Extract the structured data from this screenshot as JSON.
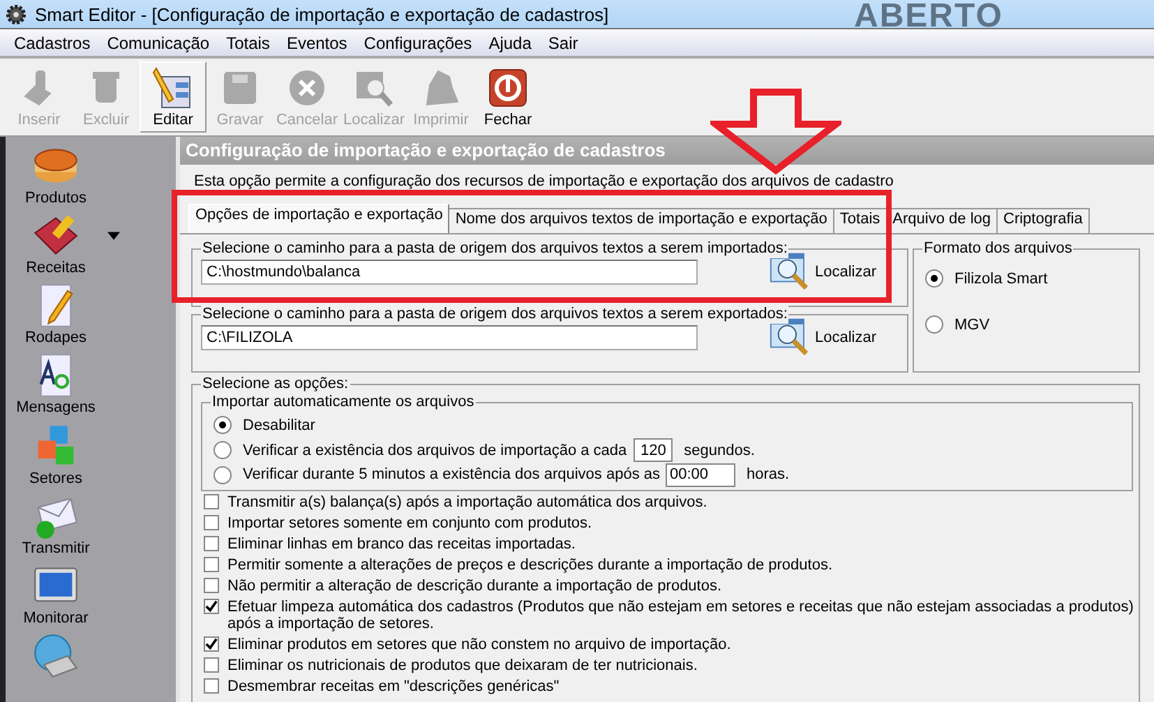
{
  "window": {
    "title": "Smart Editor  - [Configuração de importação e exportação de cadastros]",
    "backdrop_text": "ABERTO"
  },
  "menu": [
    "Cadastros",
    "Comunicação",
    "Totais",
    "Eventos",
    "Configurações",
    "Ajuda",
    "Sair"
  ],
  "toolbar": [
    {
      "label": "Inserir",
      "disabled": true,
      "selected": false
    },
    {
      "label": "Excluir",
      "disabled": true,
      "selected": false
    },
    {
      "label": "Editar",
      "disabled": false,
      "selected": true
    },
    {
      "label": "Gravar",
      "disabled": true,
      "selected": false
    },
    {
      "label": "Cancelar",
      "disabled": true,
      "selected": false
    },
    {
      "label": "Localizar",
      "disabled": true,
      "selected": false
    },
    {
      "label": "Imprimir",
      "disabled": true,
      "selected": false
    },
    {
      "label": "Fechar",
      "disabled": false,
      "selected": false
    }
  ],
  "sidebar": {
    "items": [
      {
        "label": "Produtos",
        "dropdown": false
      },
      {
        "label": "Receitas",
        "dropdown": true
      },
      {
        "label": "Rodapes",
        "dropdown": false
      },
      {
        "label": "Mensagens",
        "dropdown": false
      },
      {
        "label": "Setores",
        "dropdown": false
      },
      {
        "label": "Transmitir",
        "dropdown": false
      },
      {
        "label": "Monitorar",
        "dropdown": false
      },
      {
        "dropdown": false
      }
    ]
  },
  "panel": {
    "title": "Configuração de importação e exportação de cadastros",
    "description": "Esta opção permite a configuração dos recursos de importação e exportação dos arquivos de cadastro",
    "tabs": [
      {
        "label": "Opções de importação e exportação",
        "selected": true
      },
      {
        "label": "Nome dos arquivos textos de importação e exportação",
        "selected": false
      },
      {
        "label": "Totais",
        "selected": false
      },
      {
        "label": "Arquivo de log",
        "selected": false
      },
      {
        "label": "Criptografia",
        "selected": false
      }
    ],
    "paths": [
      {
        "label": "Selecione o caminho para a pasta de origem dos arquivos textos a serem importados:",
        "value": "C:\\hostmundo\\balanca",
        "button": "Localizar"
      },
      {
        "label": "Selecione o caminho para a pasta de origem dos arquivos textos a serem exportados:",
        "value": "C:\\FILIZOLA",
        "button": "Localizar"
      }
    ],
    "file_format": {
      "title": "Formato dos arquivos",
      "options": [
        {
          "label": "Filizola Smart",
          "selected": true
        },
        {
          "label": "MGV",
          "selected": false
        }
      ]
    },
    "options": {
      "title": "Selecione as opções:",
      "auto_import": {
        "title": "Importar automaticamente os arquivos",
        "options": [
          {
            "kind": "plain",
            "label": "Desabilitar",
            "selected": true
          },
          {
            "kind": "interval",
            "label": "Verificar a existência dos arquivos de importação a cada",
            "value": "120",
            "suffix": "segundos.",
            "selected": false
          },
          {
            "kind": "time",
            "label": "Verificar durante 5 minutos a existência dos arquivos após as",
            "value": "00:00",
            "suffix": "horas.",
            "selected": false
          }
        ]
      },
      "checkboxes": [
        {
          "label": "Transmitir a(s) balança(s) após a importação automática dos arquivos.",
          "checked": false
        },
        {
          "label": "Importar setores somente em conjunto com produtos.",
          "checked": false
        },
        {
          "label": "Eliminar linhas em branco das receitas importadas.",
          "checked": false
        },
        {
          "label": "Permitir somente a alterações de preços e descrições durante a importação de produtos.",
          "checked": false
        },
        {
          "label": "Não permitir a alteração de descrição durante a importação de produtos.",
          "checked": false
        },
        {
          "label": "Efetuar limpeza automática dos cadastros (Produtos que não estejam em setores e receitas que não estejam associadas a produtos) após a importação de setores.",
          "checked": true
        },
        {
          "label": "Eliminar produtos em setores que não constem no arquivo de importação.",
          "checked": true
        },
        {
          "label": "Eliminar os nutricionais de produtos que deixaram de  ter nutricionais.",
          "checked": false
        },
        {
          "label": "Desmembrar receitas em \"descrições genéricas\"",
          "checked": false
        }
      ]
    }
  }
}
